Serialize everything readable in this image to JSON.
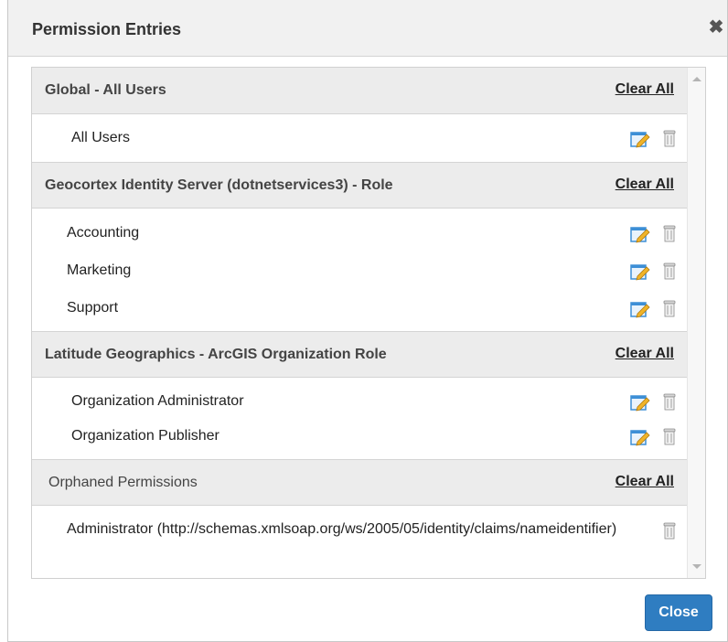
{
  "dialog": {
    "title": "Permission Entries",
    "close_glyph": "✖",
    "close_button_label": "Close"
  },
  "groups": [
    {
      "title": "Global  -  All Users",
      "clear_label": "Clear All",
      "entries": [
        {
          "label": "All Users",
          "has_edit": true,
          "has_delete": true
        }
      ]
    },
    {
      "title": "Geocortex Identity Server (dotnetservices3) -  Role",
      "clear_label": "Clear All",
      "entries": [
        {
          "label": "Accounting",
          "has_edit": true,
          "has_delete": true
        },
        {
          "label": "Marketing",
          "has_edit": true,
          "has_delete": true
        },
        {
          "label": "Support",
          "has_edit": true,
          "has_delete": true
        }
      ]
    },
    {
      "title": "Latitude Geographics -  ArcGIS Organization Role",
      "clear_label": "Clear All",
      "entries": [
        {
          "label": "Organization Administrator",
          "has_edit": true,
          "has_delete": true
        },
        {
          "label": "Organization Publisher",
          "has_edit": true,
          "has_delete": true
        }
      ]
    },
    {
      "title": "Orphaned Permissions",
      "clear_label": "Clear All",
      "entries": [
        {
          "label": "Administrator (http://schemas.xmlsoap.org/ws/2005/05/identity/claims/nameidentifier)",
          "has_edit": false,
          "has_delete": true
        }
      ]
    }
  ],
  "icons": {
    "edit": "edit-pencil-icon",
    "delete": "trash-can-icon"
  },
  "colors": {
    "header_bg": "#ececec",
    "close_button_bg": "#2f7dc1",
    "edit_icon_blue": "#3d8fd6",
    "edit_icon_pencil": "#f0b429"
  }
}
